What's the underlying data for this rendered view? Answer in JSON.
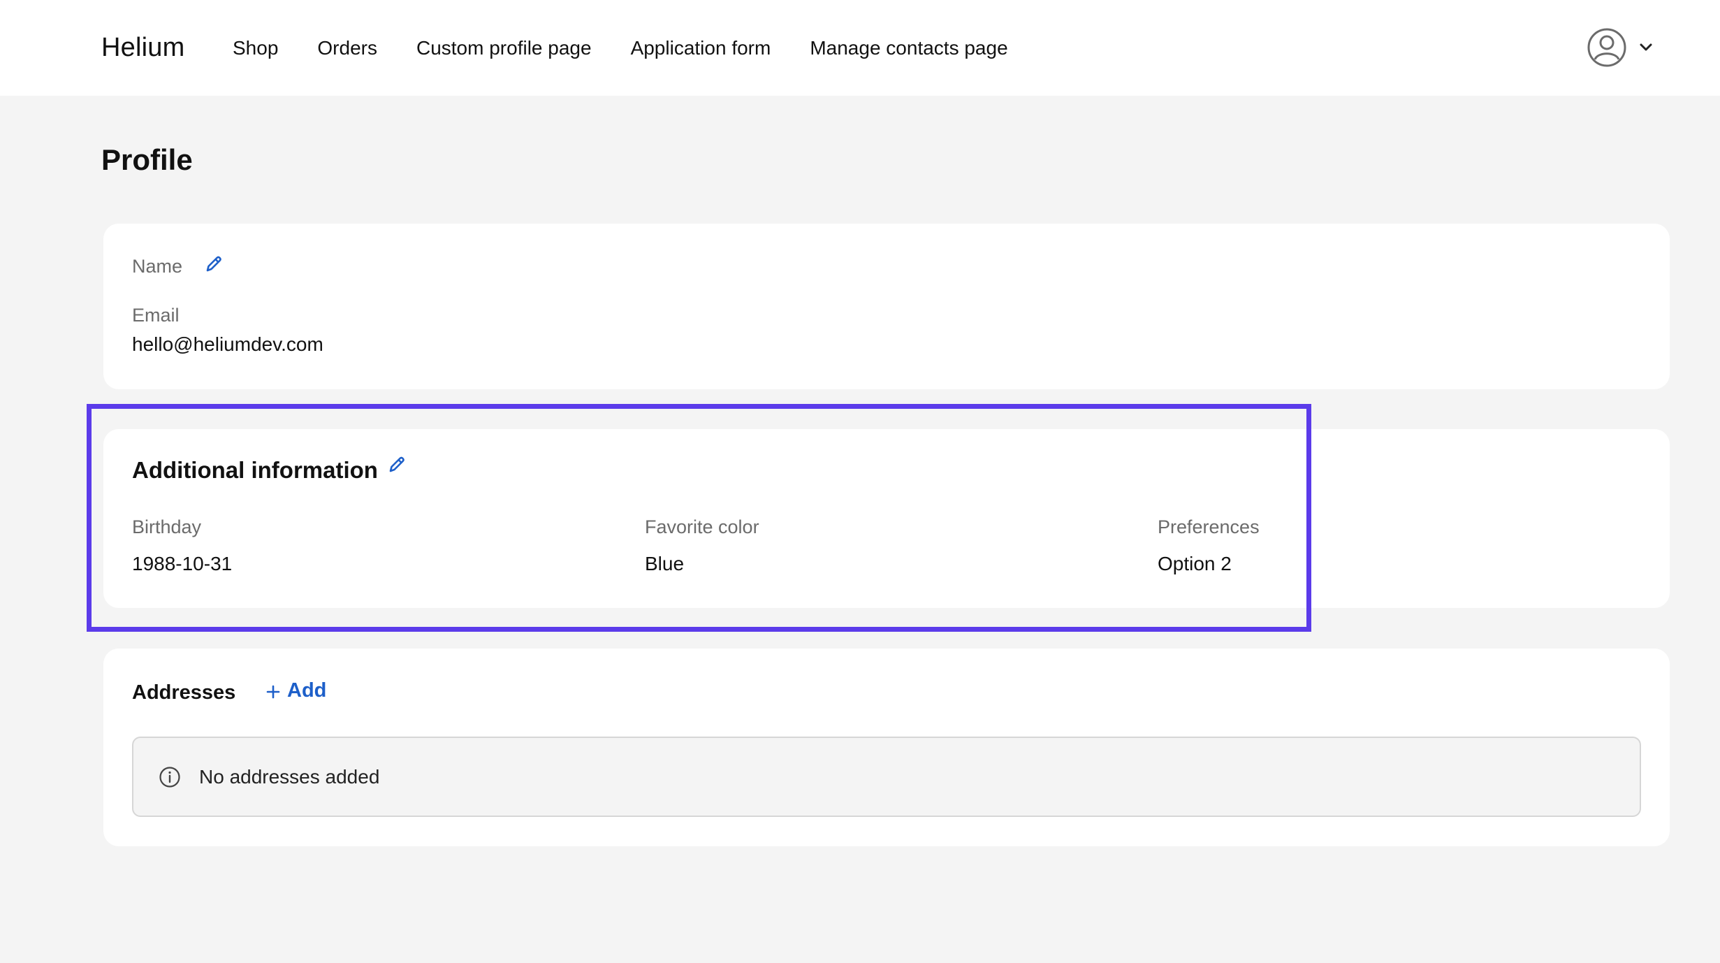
{
  "header": {
    "brand": "Helium",
    "nav": [
      {
        "label": "Shop"
      },
      {
        "label": "Orders"
      },
      {
        "label": "Custom profile page"
      },
      {
        "label": "Application form"
      },
      {
        "label": "Manage contacts page"
      }
    ],
    "account_icon": "user-circle-icon",
    "account_menu_icon": "chevron-down-icon"
  },
  "page": {
    "title": "Profile"
  },
  "profile_card": {
    "name_label": "Name",
    "email_label": "Email",
    "email_value": "hello@heliumdev.com"
  },
  "additional_info": {
    "title": "Additional information",
    "fields": [
      {
        "label": "Birthday",
        "value": "1988-10-31"
      },
      {
        "label": "Favorite color",
        "value": "Blue"
      },
      {
        "label": "Preferences",
        "value": "Option 2"
      }
    ]
  },
  "addresses": {
    "title": "Addresses",
    "add_label": "Add",
    "empty_text": "No addresses added"
  },
  "colors": {
    "accent_link": "#1d5fc9",
    "highlight_border": "#5b3bea",
    "page_bg": "#f4f4f4",
    "card_bg": "#ffffff"
  }
}
